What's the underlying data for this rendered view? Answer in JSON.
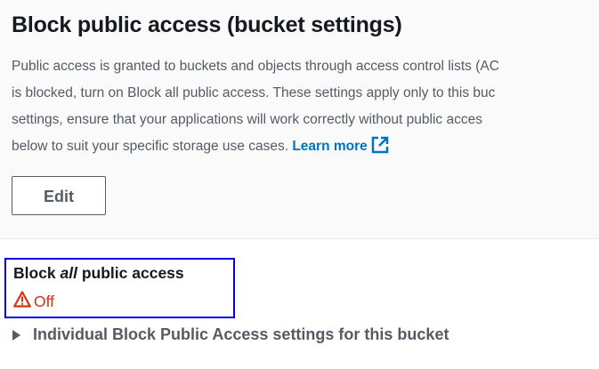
{
  "section": {
    "title": "Block public access (bucket settings)",
    "description_lines": [
      "Public access is granted to buckets and objects through access control lists (AC",
      "is blocked, turn on Block all public access. These settings apply only to this buc",
      "settings, ensure that your applications will work correctly without public acces",
      "below to suit your specific storage use cases. "
    ],
    "learn_more_label": "Learn more",
    "learn_more_icon": "external-link-icon",
    "edit_label": "Edit"
  },
  "block_all": {
    "label_prefix": "Block ",
    "label_emphasis": "all",
    "label_suffix": " public access",
    "status": "Off",
    "status_icon": "warning-icon",
    "status_color": "#d13212"
  },
  "expander": {
    "label": "Individual Block Public Access settings for this bucket",
    "icon": "caret-right-icon"
  },
  "colors": {
    "link": "#0073bb",
    "highlight_box": "#0000ee"
  }
}
